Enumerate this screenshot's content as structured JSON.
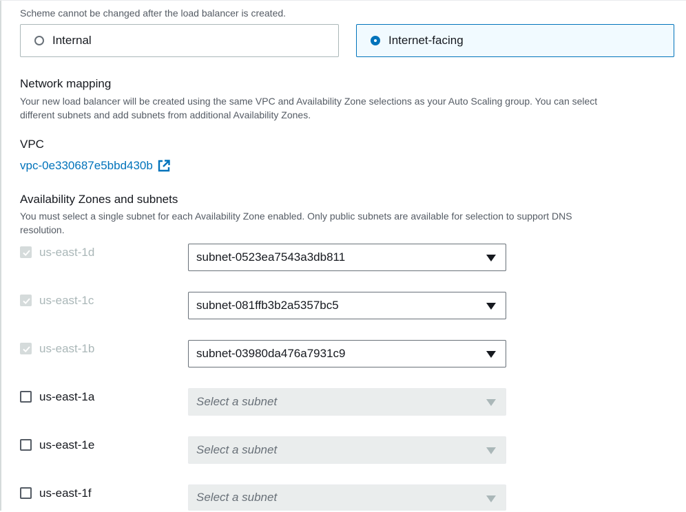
{
  "scheme": {
    "note": "Scheme cannot be changed after the load balancer is created.",
    "options": [
      {
        "label": "Internal",
        "selected": false
      },
      {
        "label": "Internet-facing",
        "selected": true
      }
    ]
  },
  "network_mapping": {
    "title": "Network mapping",
    "description_line1": "Your new load balancer will be created using the same VPC and Availability Zone selections as your Auto Scaling group. You can select",
    "description_line2": "different subnets and add subnets from additional Availability Zones."
  },
  "vpc": {
    "label": "VPC",
    "value": "vpc-0e330687e5bbd430b",
    "icon": "external-link-icon"
  },
  "zones": {
    "title": "Availability Zones and subnets",
    "description_line1": "You must select a single subnet for each Availability Zone enabled. Only public subnets are available for selection to support DNS",
    "description_line2": "resolution.",
    "items": [
      {
        "zone": "us-east-1d",
        "checked": true,
        "disabled": true,
        "subnet": "subnet-0523ea7543a3db811"
      },
      {
        "zone": "us-east-1c",
        "checked": true,
        "disabled": true,
        "subnet": "subnet-081ffb3b2a5357bc5"
      },
      {
        "zone": "us-east-1b",
        "checked": true,
        "disabled": true,
        "subnet": "subnet-03980da476a7931c9"
      },
      {
        "zone": "us-east-1a",
        "checked": false,
        "disabled": false,
        "subnet_placeholder": "Select a subnet"
      },
      {
        "zone": "us-east-1e",
        "checked": false,
        "disabled": false,
        "subnet_placeholder": "Select a subnet"
      },
      {
        "zone": "us-east-1f",
        "checked": false,
        "disabled": false,
        "subnet_placeholder": "Select a subnet"
      }
    ]
  },
  "colors": {
    "accent": "#0073bb",
    "selected_bg": "#f1faff",
    "disabled_text": "#aab7b8"
  }
}
